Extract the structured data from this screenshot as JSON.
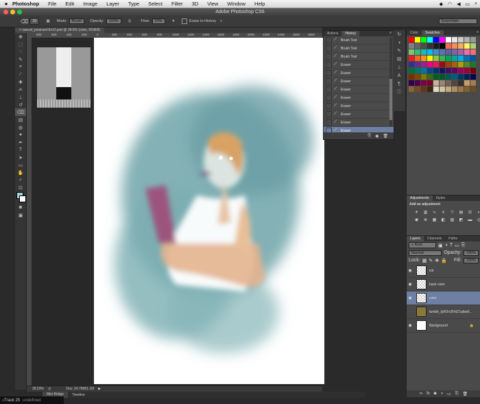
{
  "menubar": {
    "items": [
      "Photoshop",
      "File",
      "Edit",
      "Image",
      "Layer",
      "Type",
      "Select",
      "Filter",
      "3D",
      "View",
      "Window",
      "Help"
    ]
  },
  "titlebar": {
    "title": "Adobe Photoshop CS6"
  },
  "options": {
    "brush_size": "20",
    "mode_label": "Mode:",
    "mode_value": "Brush",
    "opacity_label": "Opacity:",
    "opacity_value": "100%",
    "flow_label": "Flow:",
    "flow_value": "20%",
    "erase_history_label": "Erase to History",
    "workspace": "Essentials"
  },
  "document": {
    "tab": "vancaf_postcard-8x12.psd @ 28.5% (color, RGB/8)",
    "zoom": "28.53%",
    "doc_size": "Doc: 24.7M/81.1M",
    "ruler_ticks": [
      "800",
      "600",
      "400",
      "200",
      "0",
      "200",
      "400",
      "600",
      "800",
      "1000",
      "1200",
      "1400",
      "1600",
      "1800",
      "2000",
      "2200",
      "2400",
      "2600",
      "2800"
    ]
  },
  "bottom": {
    "mini_bridge": "Mini Bridge",
    "timeline": "Timeline",
    "track": "Track 25",
    "track_sub": "undefined"
  },
  "history": {
    "tabs": [
      "Actions",
      "History"
    ],
    "items": [
      {
        "label": "Brush Tool",
        "icon": "brush-icon"
      },
      {
        "label": "Brush Tool",
        "icon": "brush-icon"
      },
      {
        "label": "Brush Tool",
        "icon": "brush-icon"
      },
      {
        "label": "Eraser",
        "icon": "eraser-icon"
      },
      {
        "label": "Eraser",
        "icon": "eraser-icon"
      },
      {
        "label": "Eraser",
        "icon": "eraser-icon"
      },
      {
        "label": "Eraser",
        "icon": "eraser-icon"
      },
      {
        "label": "Eraser",
        "icon": "eraser-icon"
      },
      {
        "label": "Eraser",
        "icon": "eraser-icon"
      },
      {
        "label": "Eraser",
        "icon": "eraser-icon"
      },
      {
        "label": "Eraser",
        "icon": "eraser-icon"
      },
      {
        "label": "Eraser",
        "icon": "eraser-icon"
      }
    ],
    "selected_index": 11
  },
  "swatches": {
    "tabs": [
      "Color",
      "Swatches"
    ],
    "colors": [
      "#ff0000",
      "#ffff00",
      "#00ff00",
      "#00ffff",
      "#0000ff",
      "#ff00ff",
      "#ffffff",
      "#e6e6e6",
      "#cccccc",
      "#b3b3b3",
      "#999999",
      "#808080",
      "#666666",
      "#4d4d4d",
      "#333333",
      "#1a1a1a",
      "#000000",
      "#f26c4f",
      "#f68e55",
      "#fbaf5c",
      "#fff467",
      "#acd372",
      "#7cc576",
      "#3bb878",
      "#1abbb4",
      "#00bff3",
      "#438ccb",
      "#5574b9",
      "#605ca8",
      "#855fa8",
      "#a763a8",
      "#f06ea9",
      "#f26d7d",
      "#ed1c24",
      "#f26522",
      "#f7941d",
      "#fff200",
      "#8dc63f",
      "#39b54a",
      "#00a651",
      "#00a99d",
      "#00aeef",
      "#0072bc",
      "#0054a6",
      "#2e3192",
      "#662d91",
      "#92278f",
      "#ec008c",
      "#ed145b",
      "#9e0b0f",
      "#a0410d",
      "#a36209",
      "#aba000",
      "#598527",
      "#1a7b30",
      "#007236",
      "#00746b",
      "#0076a3",
      "#004b80",
      "#003471",
      "#1b1464",
      "#440e62",
      "#630460",
      "#9e005d",
      "#9e0039",
      "#790000",
      "#7b2e00",
      "#7d4900",
      "#827b00",
      "#406618",
      "#005e20",
      "#005826",
      "#005952",
      "#005b7f",
      "#003663",
      "#002157",
      "#0d004c",
      "#32004b",
      "#4b0049",
      "#7b0046",
      "#7a0026",
      "#c7b299",
      "#998675",
      "#736357",
      "#534741",
      "#362f2d",
      "#c69c6d",
      "#a67c52",
      "#8c6239",
      "#754c24",
      "#603913",
      "#3c2415",
      "#e5d8c4",
      "#d5c2a3",
      "#c4a77f",
      "#b08c63",
      "#9c7447",
      "#83622f",
      "#6b4e22"
    ]
  },
  "adjustments": {
    "tabs": [
      "Adjustments",
      "Styles"
    ],
    "heading": "Add an adjustment",
    "icons": [
      "brightness-icon",
      "levels-icon",
      "curves-icon",
      "exposure-icon",
      "vibrance-icon",
      "hue-sat-icon",
      "color-balance-icon",
      "bw-icon",
      "photo-filter-icon",
      "channel-mixer-icon",
      "color-lookup-icon",
      "invert-icon",
      "posterize-icon",
      "threshold-icon",
      "gradient-map-icon",
      "selective-color-icon"
    ]
  },
  "layers": {
    "tabs": [
      "Layers",
      "Channels",
      "Paths"
    ],
    "kind": "Kind",
    "blend": "Normal",
    "opacity_label": "Opacity:",
    "opacity_value": "100%",
    "lock_label": "Lock:",
    "fill_label": "Fill:",
    "fill_value": "100%",
    "items": [
      {
        "name": "ink",
        "visible": true,
        "selected": false
      },
      {
        "name": "back color",
        "visible": true,
        "selected": false
      },
      {
        "name": "color",
        "visible": true,
        "selected": true
      },
      {
        "name": "tumblr_lp9Orc8VdZ1qfae6...",
        "visible": false,
        "selected": false
      },
      {
        "name": "Background",
        "visible": true,
        "selected": false
      }
    ]
  },
  "colors": {
    "accent_selected": "#6d7fa3",
    "canvas_teal": "#6fa3a8",
    "skin": "#e3b48f"
  }
}
